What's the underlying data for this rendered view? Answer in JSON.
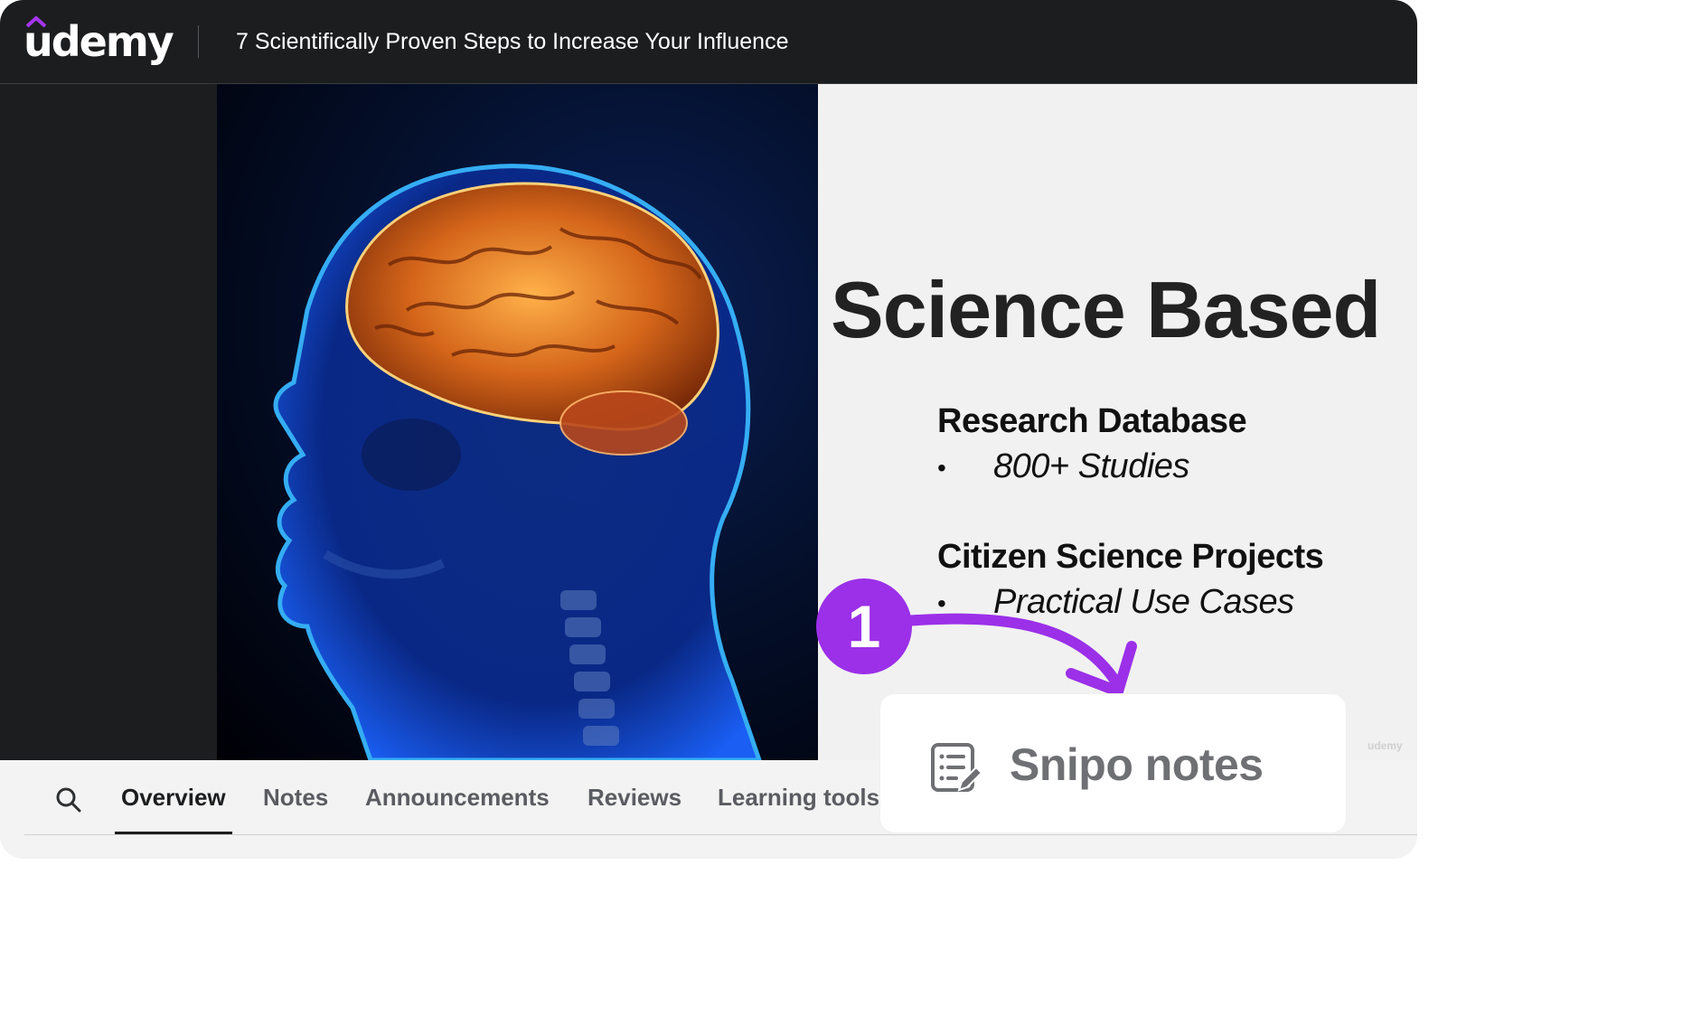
{
  "header": {
    "logo_text": "udemy",
    "course_title": "7 Scientifically Proven Steps to Increase Your Influence"
  },
  "slide": {
    "title": "Science Based",
    "sections": [
      {
        "heading": "Research Database",
        "bullet": "800+ Studies"
      },
      {
        "heading": "Citizen Science Projects",
        "bullet": "Practical Use Cases"
      }
    ],
    "bullet_glyph": "•"
  },
  "tabs": [
    {
      "label": "Overview",
      "active": true
    },
    {
      "label": "Notes",
      "active": false
    },
    {
      "label": "Announcements",
      "active": false
    },
    {
      "label": "Reviews",
      "active": false
    },
    {
      "label": "Learning tools",
      "active": false
    }
  ],
  "callout": {
    "step_number": "1",
    "label": "Snipo notes",
    "icon": "notes-edit-icon"
  },
  "icons": {
    "search": "search-icon",
    "logo_hat": "udemy-hat-icon"
  },
  "colors": {
    "header_bg": "#1c1d1f",
    "udemy_purple": "#a435f0",
    "callout_purple": "#9b30e8",
    "slide_bg": "#f1f1f1"
  }
}
